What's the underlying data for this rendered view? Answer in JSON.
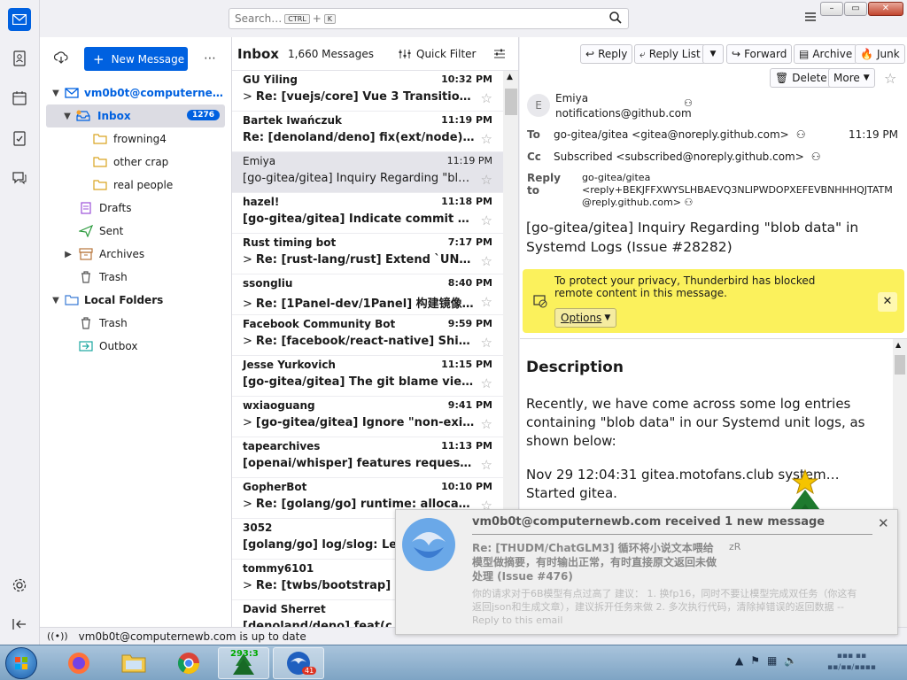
{
  "search": {
    "placeholder": "Search…",
    "key1": "CTRL",
    "plus": "+",
    "key2": "K"
  },
  "folder_pane": {
    "new_message": "New Message",
    "more": "⋯",
    "account": "vm0b0t@computerne…",
    "folders": [
      {
        "name": "Inbox",
        "badge": "1276"
      },
      {
        "name": "frowning4"
      },
      {
        "name": "other crap"
      },
      {
        "name": "real people"
      },
      {
        "name": "Drafts"
      },
      {
        "name": "Sent"
      },
      {
        "name": "Archives"
      },
      {
        "name": "Trash"
      }
    ],
    "local_folders": "Local Folders",
    "local_items": [
      "Trash",
      "Outbox"
    ]
  },
  "thread_pane": {
    "title": "Inbox",
    "count": "1,660 Messages",
    "quick_filter": "Quick Filter",
    "messages": [
      {
        "sender": "GU Yiling",
        "time": "10:32 PM",
        "subject": "Re: [vuejs/core] Vue 3 Transition …",
        "thread": true,
        "read": false
      },
      {
        "sender": "Bartek Iwańczuk",
        "time": "11:19 PM",
        "subject": "Re: [denoland/deno] fix(ext/node): a…",
        "thread": false,
        "read": false
      },
      {
        "sender": "Emiya",
        "time": "11:19 PM",
        "subject": "[go-gitea/gitea] Inquiry Regarding \"blob da…",
        "thread": false,
        "read": true,
        "selected": true
      },
      {
        "sender": "hazel!",
        "time": "11:18 PM",
        "subject": "[go-gitea/gitea] Indicate commit veri…",
        "thread": false,
        "read": false
      },
      {
        "sender": "Rust timing bot",
        "time": "7:17 PM",
        "subject": "Re: [rust-lang/rust] Extend `UNUSE…",
        "thread": true,
        "read": false
      },
      {
        "sender": "ssongliu",
        "time": "8:40 PM",
        "subject": "Re: [1Panel-dev/1Panel] 构建镜像…",
        "thread": true,
        "read": false
      },
      {
        "sender": "Facebook Community Bot",
        "time": "9:59 PM",
        "subject": "Re: [facebook/react-native] Ship \"…",
        "thread": true,
        "read": false
      },
      {
        "sender": "Jesse Yurkovich",
        "time": "11:15 PM",
        "subject": "[go-gitea/gitea] The git blame view f…",
        "thread": false,
        "read": false
      },
      {
        "sender": "wxiaoguang",
        "time": "9:41 PM",
        "subject": "[go-gitea/gitea] Ignore \"non-existi…",
        "thread": true,
        "read": false
      },
      {
        "sender": "tapearchives",
        "time": "11:13 PM",
        "subject": "[openai/whisper] features requests …",
        "thread": false,
        "read": false
      },
      {
        "sender": "GopherBot",
        "time": "10:10 PM",
        "subject": "Re: [golang/go] runtime: allocated …",
        "thread": true,
        "read": false
      },
      {
        "sender": "3052",
        "time": "",
        "subject": "[golang/go] log/slog: Leve",
        "thread": false,
        "read": false
      },
      {
        "sender": "tommy6101",
        "time": "",
        "subject": "Re: [twbs/bootstrap] C",
        "thread": true,
        "read": false
      },
      {
        "sender": "David Sherret",
        "time": "",
        "subject": "[denoland/deno] feat(c",
        "thread": false,
        "read": false
      }
    ]
  },
  "message": {
    "actions": [
      "Reply",
      "Reply List",
      "Forward",
      "Archive",
      "Junk",
      "Delete",
      "More"
    ],
    "avatar_letter": "E",
    "from_name": "Emiya",
    "from_addr": "notifications@github.com",
    "to_label": "To",
    "to": "go-gitea/gitea <gitea@noreply.github.com>",
    "time": "11:19 PM",
    "cc_label": "Cc",
    "cc": "Subscribed <subscribed@noreply.github.com>",
    "replyto_label": "Reply to",
    "replyto_1": "go-gitea/gitea",
    "replyto_2": "<reply+BEKJFFXWYSLHBAEVQ3NLIPWDOPXEFEVBNHHHQJTATM",
    "replyto_3": "@reply.github.com>",
    "subject": "[go-gitea/gitea] Inquiry Regarding \"blob data\" in Systemd Logs (Issue #28282)",
    "privacy_text": "To protect your privacy, Thunderbird has blocked remote content in this message.",
    "options": "Options",
    "body_heading": "Description",
    "body_p1": "Recently, we have come across some log entries containing \"blob data\" in our Systemd unit logs, as shown below:",
    "body_p2": "Nov 29 12:04:31 gitea.motofans.club system… Started gitea."
  },
  "status": {
    "text": "vm0b0t@computernewb.com is up to date"
  },
  "notification": {
    "title": "vm0b0t@computernewb.com received 1 new message",
    "subject": "Re: [THUDM/ChatGLM3] 循环将小说文本喂给模型做摘要，有时输出正常，有时直接原文返回未做处理 (Issue #476)",
    "sender": "zR",
    "preview": "你的请求对于6B模型有点过高了 建议： 1. 换fp16，同时不要让模型完成双任务（你这有返回json和生成文章），建议拆开任务来做 2. 多次执行代码，清除掉错误的返回数据 -- Reply to this email"
  },
  "taskbar": {
    "counter": "293:3",
    "thunderbird_badge": "41"
  },
  "colors": {
    "accent": "#0061e0",
    "privacy_bar": "#fbf15c"
  }
}
